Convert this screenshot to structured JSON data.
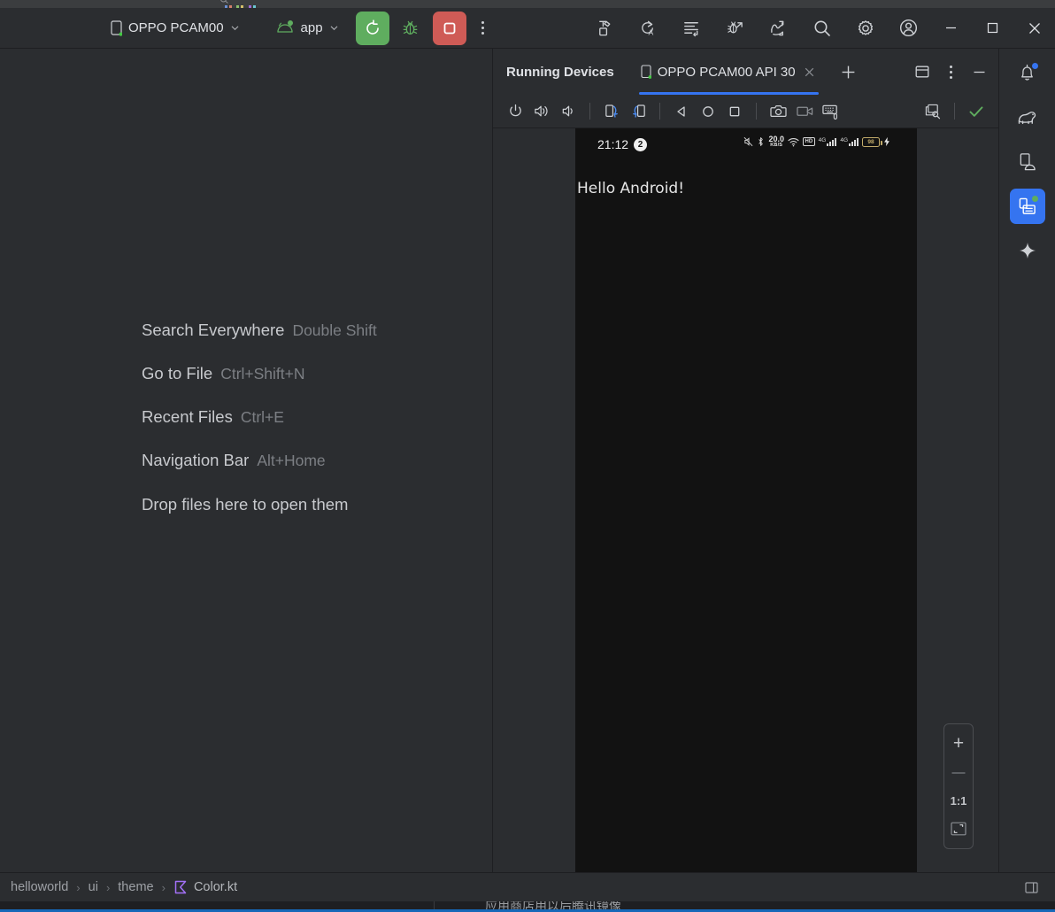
{
  "window": {
    "background_ghost_text": "",
    "bottom_ghost_text": "应用商店用以后腾讯镜像"
  },
  "toolbar": {
    "device_selector": {
      "label": "OPPO PCAM00",
      "icon": "phone-icon",
      "status_dot": "#44c944"
    },
    "run_config": {
      "label": "app",
      "icon": "android-head-icon"
    },
    "run_button": {
      "name": "run-button",
      "icon": "rerun-icon",
      "color": "#5fad5f"
    },
    "debug_button": {
      "name": "debug-button",
      "icon": "bug-icon",
      "color": "#5fad5f"
    },
    "stop_button": {
      "name": "stop-button",
      "icon": "stop-square-icon",
      "color": "#cf5b56"
    },
    "more_button": {
      "name": "more-options-button",
      "icon": "kebab-icon"
    },
    "right_icons": [
      {
        "name": "build-button",
        "icon": "hammer-icon"
      },
      {
        "name": "code-refactor-button",
        "icon": "refactor-a-icon"
      },
      {
        "name": "format-code-button",
        "icon": "reformat-icon"
      },
      {
        "name": "debug-attach-button",
        "icon": "bug-arrow-icon"
      },
      {
        "name": "profiler-button",
        "icon": "profiler-icon"
      },
      {
        "name": "search-button",
        "icon": "search-icon"
      },
      {
        "name": "settings-button",
        "icon": "gear-icon"
      },
      {
        "name": "account-button",
        "icon": "account-icon"
      }
    ],
    "window_controls": [
      {
        "name": "minimize-button",
        "icon": "minimize-icon"
      },
      {
        "name": "maximize-button",
        "icon": "maximize-icon"
      },
      {
        "name": "close-button",
        "icon": "close-icon"
      }
    ]
  },
  "editor": {
    "hints": [
      {
        "action": "Search Everywhere",
        "shortcut": "Double Shift"
      },
      {
        "action": "Go to File",
        "shortcut": "Ctrl+Shift+N"
      },
      {
        "action": "Recent Files",
        "shortcut": "Ctrl+E"
      },
      {
        "action": "Navigation Bar",
        "shortcut": "Alt+Home"
      }
    ],
    "drop_hint": "Drop files here to open them"
  },
  "running_devices": {
    "title": "Running Devices",
    "tab": {
      "label": "OPPO PCAM00 API 30",
      "icon": "phone-icon",
      "close_icon": "close-icon",
      "active": true
    },
    "add_tab": {
      "name": "add-device-tab-button",
      "icon": "plus-icon"
    },
    "header_buttons": [
      {
        "name": "split-window-button",
        "icon": "split-window-icon"
      },
      {
        "name": "options-button",
        "icon": "kebab-icon"
      },
      {
        "name": "hide-button",
        "icon": "minimize-icon"
      }
    ],
    "emulator_toolbar": [
      {
        "name": "power-button",
        "icon": "power-icon"
      },
      {
        "name": "volume-up-button",
        "icon": "volume-up-icon"
      },
      {
        "name": "volume-down-button",
        "icon": "volume-down-icon"
      },
      {
        "name": "rotate-left-button",
        "icon": "rotate-left-icon"
      },
      {
        "name": "rotate-right-button",
        "icon": "rotate-right-icon"
      },
      {
        "name": "back-button",
        "icon": "back-triangle-icon"
      },
      {
        "name": "home-button",
        "icon": "home-circle-icon"
      },
      {
        "name": "overview-button",
        "icon": "overview-square-icon"
      },
      {
        "name": "screenshot-button",
        "icon": "camera-icon"
      },
      {
        "name": "screen-record-button",
        "icon": "video-camera-icon"
      },
      {
        "name": "hardware-input-button",
        "icon": "keyboard-icon"
      }
    ],
    "emulator_toolbar_right": [
      {
        "name": "layout-inspector-button",
        "icon": "layout-inspector-icon"
      },
      {
        "name": "status-ok-indicator",
        "icon": "checkmark-icon",
        "color": "#5fad5f"
      }
    ],
    "zoom_controls": {
      "zoom_in": {
        "name": "zoom-in-button",
        "label": "+"
      },
      "zoom_out": {
        "name": "zoom-out-button",
        "label": "—"
      },
      "actual_size": {
        "name": "actual-size-button",
        "label": "1:1"
      },
      "fit_to_screen": {
        "name": "fit-to-screen-button",
        "icon": "fit-screen-icon"
      }
    }
  },
  "device_screen": {
    "status_bar": {
      "clock": "21:12",
      "notification_count": "2",
      "network_speed_value": "20.0",
      "network_speed_unit": "KB/S",
      "hd_label": "HD",
      "signal_label_1": "4G",
      "signal_label_2": "4G",
      "battery_level": "98",
      "icons": [
        "mute-icon",
        "bluetooth-icon",
        "network-speed-icon",
        "wifi-icon",
        "hd-icon",
        "signal-icon",
        "signal-icon",
        "battery-icon",
        "charging-bolt-icon"
      ]
    },
    "app_text": "Hello Android!",
    "background": "#121212"
  },
  "tool_stripe": [
    {
      "name": "notifications-button",
      "icon": "bell-icon",
      "badge": "blue",
      "active": false
    },
    {
      "name": "gradle-button",
      "icon": "gradle-elephant-icon",
      "badge": null,
      "active": false
    },
    {
      "name": "device-manager-button",
      "icon": "device-manager-icon",
      "badge": null,
      "active": false
    },
    {
      "name": "running-devices-button",
      "icon": "running-devices-icon",
      "badge": "green",
      "active": true
    },
    {
      "name": "gemini-button",
      "icon": "sparkle-icon",
      "badge": null,
      "active": false
    }
  ],
  "status_bar": {
    "breadcrumb": [
      {
        "label": "helloworld",
        "icon": null
      },
      {
        "label": "ui",
        "icon": null
      },
      {
        "label": "theme",
        "icon": null
      },
      {
        "label": "Color.kt",
        "icon": "kotlin-file-icon"
      }
    ],
    "separator": "›",
    "right_icon": {
      "name": "layout-toggle-button",
      "icon": "panel-icon"
    }
  }
}
